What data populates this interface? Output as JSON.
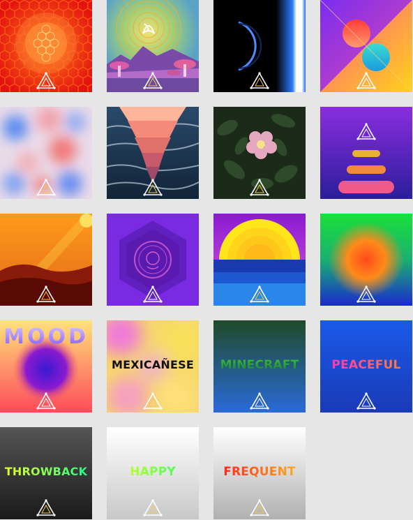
{
  "gallery": {
    "tiles": [
      {
        "name": "tile-red-honeycomb",
        "word": ""
      },
      {
        "name": "tile-psychedelic-mushrooms",
        "word": ""
      },
      {
        "name": "tile-black-eclipse",
        "word": ""
      },
      {
        "name": "tile-diagonal-sun",
        "word": ""
      },
      {
        "name": "tile-pastel-blobs",
        "word": ""
      },
      {
        "name": "tile-ocean-prism",
        "word": ""
      },
      {
        "name": "tile-wild-rose",
        "word": ""
      },
      {
        "name": "tile-stacked-bars",
        "word": ""
      },
      {
        "name": "tile-orange-dunes",
        "word": ""
      },
      {
        "name": "tile-purple-medallion",
        "word": ""
      },
      {
        "name": "tile-sunset-sea",
        "word": ""
      },
      {
        "name": "tile-green-orb",
        "word": ""
      },
      {
        "name": "tile-mood",
        "word": "MOOD"
      },
      {
        "name": "tile-mexicanese",
        "word": "MEXICAÑESE"
      },
      {
        "name": "tile-minecraft",
        "word": "MINECRAFT"
      },
      {
        "name": "tile-peaceful",
        "word": "PEACEFUL"
      },
      {
        "name": "tile-throwback",
        "word": "THROWBACK"
      },
      {
        "name": "tile-happy",
        "word": "HAPPY"
      },
      {
        "name": "tile-frequent",
        "word": "FREQUENT"
      }
    ]
  },
  "colors": {
    "logo_stroke": "#ffffff",
    "logo_fill": "#f2c94c"
  },
  "icons": {
    "tile_logo": "triangle-logo-icon"
  }
}
